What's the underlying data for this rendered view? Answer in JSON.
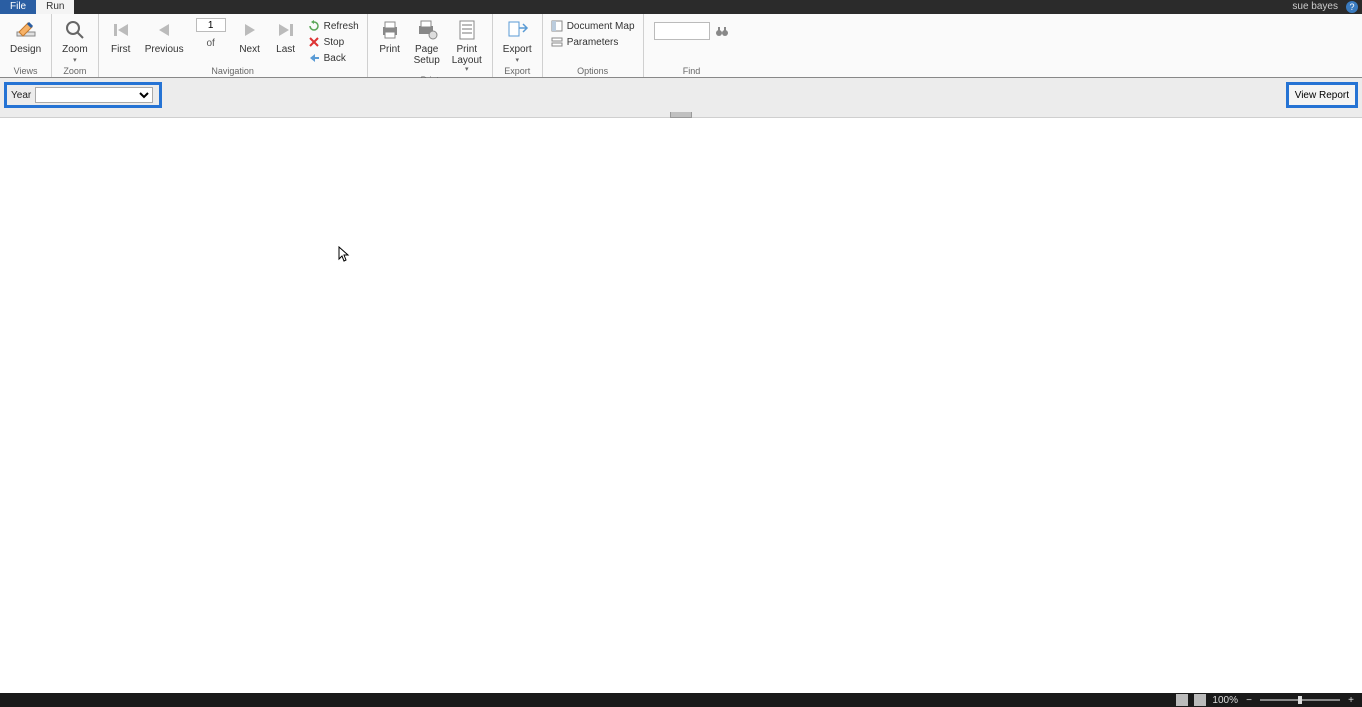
{
  "titlebar": {
    "file_tab": "File",
    "run_tab": "Run",
    "user": "sue bayes",
    "help": "?"
  },
  "ribbon": {
    "views": {
      "design": "Design",
      "group": "Views"
    },
    "zoom": {
      "zoom": "Zoom",
      "group": "Zoom"
    },
    "navigation": {
      "first": "First",
      "previous": "Previous",
      "page_value": "1",
      "of": "of",
      "next": "Next",
      "last": "Last",
      "refresh": "Refresh",
      "stop": "Stop",
      "back": "Back",
      "group": "Navigation"
    },
    "print": {
      "print": "Print",
      "page_setup1": "Page",
      "page_setup2": "Setup",
      "print_layout1": "Print",
      "print_layout2": "Layout",
      "group": "Print"
    },
    "export": {
      "export": "Export",
      "group": "Export"
    },
    "options": {
      "document_map": "Document Map",
      "parameters": "Parameters",
      "group": "Options"
    },
    "find": {
      "group": "Find"
    }
  },
  "param_bar": {
    "year_label": "Year",
    "year_value": "",
    "view_report": "View Report"
  },
  "statusbar": {
    "zoom_pct": "100%",
    "minus": "−",
    "plus": "+"
  }
}
